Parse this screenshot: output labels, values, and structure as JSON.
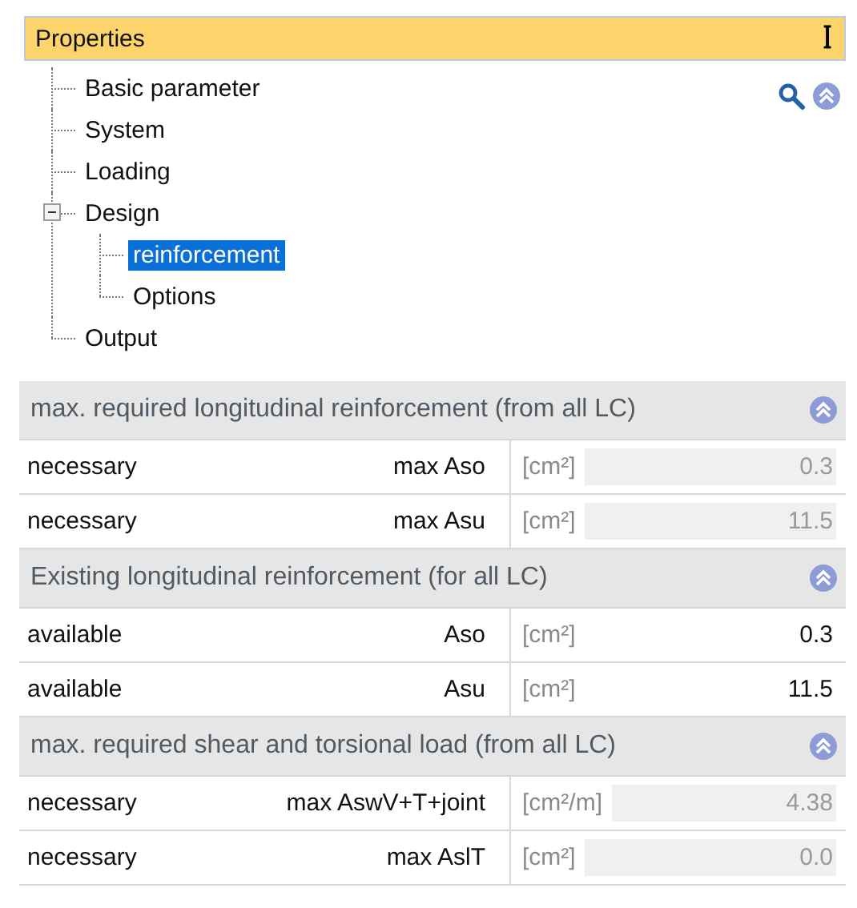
{
  "panel": {
    "title": "Properties",
    "pin": "ꟾ"
  },
  "tree": [
    {
      "label": "Basic parameter",
      "selected": false
    },
    {
      "label": "System",
      "selected": false
    },
    {
      "label": "Loading",
      "selected": false
    },
    {
      "label": "Design",
      "selected": false,
      "expanded": true,
      "children": [
        {
          "label": "reinforcement",
          "selected": true
        },
        {
          "label": "Options",
          "selected": false
        }
      ]
    },
    {
      "label": "Output",
      "selected": false
    }
  ],
  "sections": [
    {
      "title": "max. required longitudinal reinforcement (from all LC)",
      "rows": [
        {
          "label": "necessary",
          "symbol": "max Aso",
          "unit": "[cm²]",
          "value": "0.3",
          "readonly": true
        },
        {
          "label": "necessary",
          "symbol": "max Asu",
          "unit": "[cm²]",
          "value": "11.5",
          "readonly": true
        }
      ]
    },
    {
      "title": "Existing longitudinal reinforcement (for all LC)",
      "rows": [
        {
          "label": "available",
          "symbol": "Aso",
          "unit": "[cm²]",
          "value": "0.3",
          "readonly": false
        },
        {
          "label": "available",
          "symbol": "Asu",
          "unit": "[cm²]",
          "value": "11.5",
          "readonly": false
        }
      ]
    },
    {
      "title": "max. required shear and torsional load (from all LC)",
      "rows": [
        {
          "label": "necessary",
          "symbol": "max AswV+T+joint",
          "unit": "[cm²/m]",
          "value": "4.38",
          "readonly": true
        },
        {
          "label": "necessary",
          "symbol": "max AslT",
          "unit": "[cm²]",
          "value": "0.0",
          "readonly": true
        }
      ]
    }
  ]
}
